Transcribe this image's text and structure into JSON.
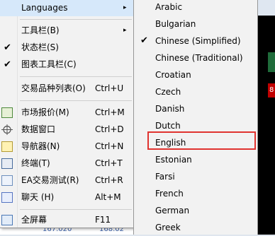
{
  "main_menu": {
    "items": [
      {
        "label": "Languages",
        "shortcut": "",
        "arrow": "▸",
        "check": "",
        "highlight": true
      },
      {
        "label": "工具栏(B)",
        "shortcut": "",
        "arrow": "▸",
        "check": ""
      },
      {
        "label": "状态栏(S)",
        "shortcut": "",
        "arrow": "",
        "check": "✔"
      },
      {
        "label": "图表工具栏(C)",
        "shortcut": "",
        "arrow": "",
        "check": "✔"
      },
      {
        "label": "交易品种列表(O)",
        "shortcut": "Ctrl+U",
        "arrow": "",
        "check": ""
      },
      {
        "label": "市场报价(M)",
        "shortcut": "Ctrl+M",
        "icon": "market-watch-icon"
      },
      {
        "label": "数据窗口",
        "shortcut": "Ctrl+D",
        "icon": "crosshair-icon"
      },
      {
        "label": "导航器(N)",
        "shortcut": "Ctrl+N",
        "icon": "navigator-icon"
      },
      {
        "label": "终端(T)",
        "shortcut": "Ctrl+T",
        "icon": "terminal-icon"
      },
      {
        "label": "EA交易测试(R)",
        "shortcut": "Ctrl+R",
        "icon": "strategy-tester-icon"
      },
      {
        "label": "聊天 (H)",
        "shortcut": "Alt+M",
        "icon": "chat-icon"
      },
      {
        "label": "全屏幕",
        "shortcut": "F11",
        "icon": "fullscreen-icon"
      }
    ]
  },
  "languages_submenu": {
    "items": [
      "Arabic",
      "Bulgarian",
      "Chinese (Simplified)",
      "Chinese (Traditional)",
      "Croatian",
      "Czech",
      "Danish",
      "Dutch",
      "English",
      "Estonian",
      "Farsi",
      "French",
      "German",
      "Greek"
    ],
    "checked": "Chinese (Simplified)",
    "check_mark": "✔",
    "highlighted": "English",
    "highlight_color": "#e0332f"
  },
  "background": {
    "right_tab_text": "8",
    "bottom_values": [
      "167.020",
      "168.02"
    ]
  }
}
